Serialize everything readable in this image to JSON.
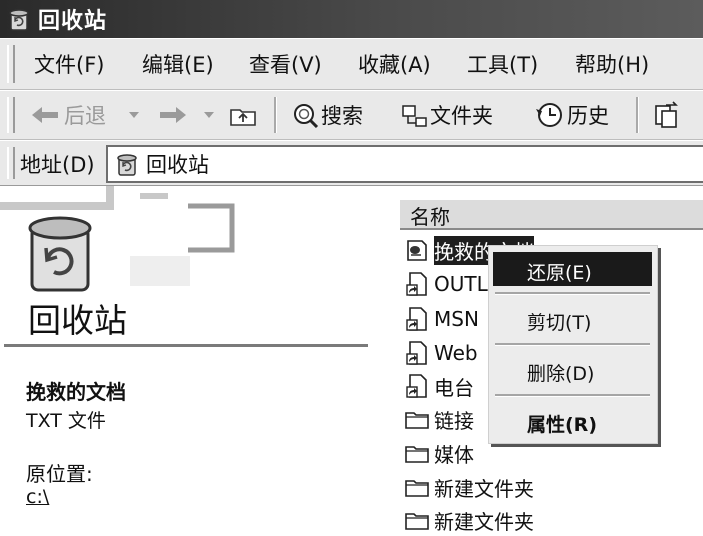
{
  "window": {
    "title": "回收站",
    "icon": "recycle-bin-icon"
  },
  "menubar": {
    "items": [
      "文件(F)",
      "编辑(E)",
      "查看(V)",
      "收藏(A)",
      "工具(T)",
      "帮助(H)"
    ]
  },
  "toolbar": {
    "back": "后退",
    "search": "搜索",
    "folders": "文件夹",
    "history": "历史"
  },
  "address": {
    "label": "地址(D)",
    "value": "回收站"
  },
  "left_panel": {
    "title": "回收站",
    "selected_name": "挽救的文档",
    "selected_type": "TXT 文件",
    "location_label": "原位置:",
    "location_value": "c:\\"
  },
  "file_list": {
    "column_name": "名称",
    "items": [
      {
        "name": "挽救的文档",
        "icon": "text-file-icon",
        "selected": true
      },
      {
        "name": "OUTL",
        "icon": "shortcut-icon"
      },
      {
        "name": "MSN",
        "icon": "shortcut-icon"
      },
      {
        "name": "Web",
        "icon": "shortcut-icon"
      },
      {
        "name": "电台",
        "icon": "shortcut-icon"
      },
      {
        "name": "链接",
        "icon": "folder-icon"
      },
      {
        "name": "媒体",
        "icon": "folder-icon"
      },
      {
        "name": "新建文件夹",
        "icon": "folder-icon"
      },
      {
        "name": "新建文件夹",
        "icon": "folder-icon"
      }
    ]
  },
  "context_menu": {
    "restore": "还原(E)",
    "cut": "剪切(T)",
    "delete": "删除(D)",
    "properties": "属性(R)"
  },
  "colors": {
    "selection": "#1e1e1e",
    "titlebar": "#3a3a3a",
    "chrome": "#e9e9e9"
  }
}
